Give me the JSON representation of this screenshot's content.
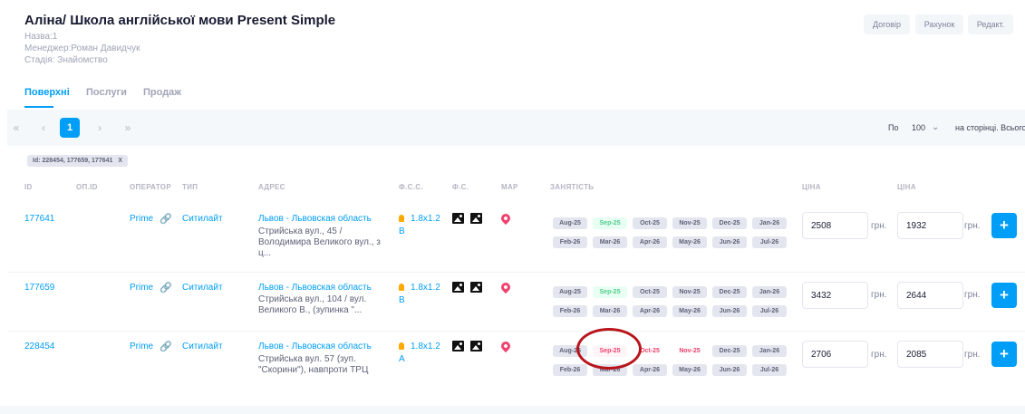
{
  "header": {
    "title": "Аліна/ Школа англійської мови Present Simple",
    "name_line": "Назва:1",
    "manager_line": "Менеджер:Роман Давидчук",
    "stage_line": "Стадія: Знайомство",
    "buttons": {
      "contract": "Договір",
      "invoice": "Рахунок",
      "edit": "Редакт."
    }
  },
  "tabs": [
    {
      "label": "Поверхні",
      "active": true
    },
    {
      "label": "Послуги",
      "active": false
    },
    {
      "label": "Продаж",
      "active": false
    }
  ],
  "pagination": {
    "first": "«",
    "prev": "‹",
    "current_page": "1",
    "next": "›",
    "last": "»",
    "per_page_prefix": "По",
    "per_page_value": "100",
    "per_page_suffix": "на сторінці. Всього"
  },
  "filter_chip": {
    "label": "Id: 228454, 177659, 177641",
    "close": "X"
  },
  "table": {
    "headers": {
      "id": "ID",
      "op_id": "ОП.ID",
      "operator": "ОПЕРАТОР",
      "type": "ТИП",
      "address": "АДРЕС",
      "fss": "Ф.С.С.",
      "fs": "Ф.С.",
      "map": "МАР",
      "occupancy": "ЗАНЯТІСТЬ",
      "price1": "ЦІНА",
      "price2": "ЦІНА"
    },
    "rows": [
      {
        "id": "177641",
        "operator": "Prime",
        "type": "Ситилайт",
        "city": "Львов - Львовская область",
        "address": "Стрийська вул., 45 / Володимира Великого вул., з ц...",
        "size": "1.8x1.2",
        "side": "B",
        "months": [
          {
            "label": "Aug-25",
            "state": "busy"
          },
          {
            "label": "Sep-25",
            "state": "free"
          },
          {
            "label": "Oct-25",
            "state": "busy"
          },
          {
            "label": "Nov-25",
            "state": "busy"
          },
          {
            "label": "Dec-25",
            "state": "busy"
          },
          {
            "label": "Jan-26",
            "state": "busy"
          },
          {
            "label": "Feb-26",
            "state": "busy"
          },
          {
            "label": "Mar-26",
            "state": "busy"
          },
          {
            "label": "Apr-26",
            "state": "busy"
          },
          {
            "label": "May-26",
            "state": "busy"
          },
          {
            "label": "Jun-26",
            "state": "busy"
          },
          {
            "label": "Jul-26",
            "state": "busy"
          }
        ],
        "price1": "2508",
        "price2": "1932",
        "currency": "грн."
      },
      {
        "id": "177659",
        "operator": "Prime",
        "type": "Ситилайт",
        "city": "Львов - Львовская область",
        "address": "Стрийська вул., 104 / вул. Великого В., (зупинка \"...",
        "size": "1.8x1.2",
        "side": "B",
        "months": [
          {
            "label": "Aug-25",
            "state": "busy"
          },
          {
            "label": "Sep-25",
            "state": "free"
          },
          {
            "label": "Oct-25",
            "state": "busy"
          },
          {
            "label": "Nov-25",
            "state": "busy"
          },
          {
            "label": "Dec-25",
            "state": "busy"
          },
          {
            "label": "Jan-26",
            "state": "busy"
          },
          {
            "label": "Feb-26",
            "state": "busy"
          },
          {
            "label": "Mar-26",
            "state": "busy"
          },
          {
            "label": "Apr-26",
            "state": "busy"
          },
          {
            "label": "May-26",
            "state": "busy"
          },
          {
            "label": "Jun-26",
            "state": "busy"
          },
          {
            "label": "Jul-26",
            "state": "busy"
          }
        ],
        "price1": "3432",
        "price2": "2644",
        "currency": "грн."
      },
      {
        "id": "228454",
        "operator": "Prime",
        "type": "Ситилайт",
        "city": "Львов - Львовская область",
        "address": "Стрийська вул. 57 (зуп. \"Скорини\"), навпроти ТРЦ \"...",
        "size": "1.8x1.2",
        "side": "A",
        "months": [
          {
            "label": "Aug-25",
            "state": "busy"
          },
          {
            "label": "Sep-25",
            "state": "reserved"
          },
          {
            "label": "Oct-25",
            "state": "reserved-white"
          },
          {
            "label": "Nov-25",
            "state": "reserved-white"
          },
          {
            "label": "Dec-25",
            "state": "busy"
          },
          {
            "label": "Jan-26",
            "state": "busy"
          },
          {
            "label": "Feb-26",
            "state": "busy"
          },
          {
            "label": "Mar-26",
            "state": "busy"
          },
          {
            "label": "Apr-26",
            "state": "busy"
          },
          {
            "label": "May-26",
            "state": "busy"
          },
          {
            "label": "Jun-26",
            "state": "busy"
          },
          {
            "label": "Jul-26",
            "state": "busy"
          }
        ],
        "price1": "2706",
        "price2": "2085",
        "currency": "грн."
      }
    ],
    "add_button": "+"
  },
  "colors": {
    "accent": "#009ef7",
    "free": "#50cd89",
    "reserved": "#f1416c",
    "annotation_circle": "#b8141b"
  }
}
